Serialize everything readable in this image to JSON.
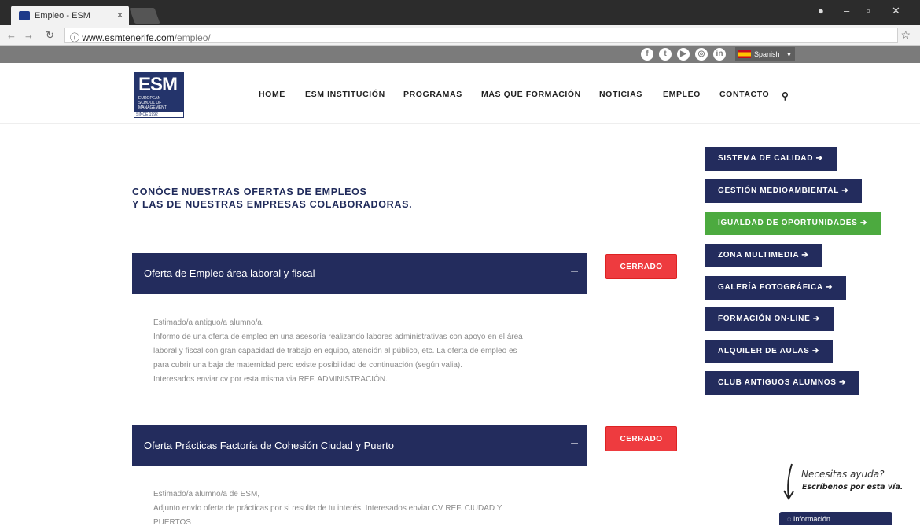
{
  "browser": {
    "tab_title": "Empleo - ESM",
    "tab_close": "×",
    "url_host": "www.esmtenerife.com",
    "url_path": "/empleo/"
  },
  "topstrip": {
    "language": "Spanish",
    "social": [
      "f",
      "t",
      "yt",
      "ig",
      "in"
    ]
  },
  "logo": {
    "big": "ESM",
    "small": "EUROPEAN\nSCHOOL OF\nMANAGEMENT",
    "since": "SINCE 1992"
  },
  "nav": {
    "items": [
      "HOME",
      "ESM INSTITUCIÓN",
      "PROGRAMAS",
      "MÁS QUE FORMACIÓN",
      "NOTICIAS",
      "EMPLEO",
      "CONTACTO"
    ]
  },
  "main": {
    "heading_line1": "CONÓCE NUESTRAS OFERTAS DE EMPLEOS",
    "heading_line2": "Y LAS DE NUESTRAS EMPRESAS COLABORADORAS.",
    "offers": [
      {
        "title": "Oferta de Empleo área laboral y fiscal",
        "status": "CERRADO",
        "lines": [
          "Estimado/a antiguo/a alumno/a.",
          "Informo de una oferta de empleo en una asesoría realizando labores administrativas con apoyo en el área",
          "laboral y fiscal con gran capacidad de trabajo en equipo, atención al público, etc. La oferta de empleo es",
          "para cubrir una baja de maternidad pero existe posibilidad de continuación (según valia).",
          "Interesados enviar cv por esta misma via REF. ADMINISTRACIÓN."
        ]
      },
      {
        "title": "Oferta Prácticas Factoría de Cohesión Ciudad y Puerto",
        "status": "CERRADO",
        "lines": [
          "Estimado/a alumno/a de ESM,",
          "Adjunto envío oferta de prácticas por si resulta de tu interés. Interesados enviar CV REF. CIUDAD Y",
          "PUERTOS"
        ]
      }
    ]
  },
  "sidebar": {
    "items": [
      {
        "label": "SISTEMA DE CALIDAD ➔"
      },
      {
        "label": "GESTIÓN MEDIOAMBIENTAL ➔"
      },
      {
        "label": "IGUALDAD DE OPORTUNIDADES ➔"
      },
      {
        "label": "ZONA MULTIMEDIA ➔"
      },
      {
        "label": "GALERÍA FOTOGRÁFICA ➔"
      },
      {
        "label": "FORMACIÓN ON-LINE ➔"
      },
      {
        "label": "ALQUILER DE AULAS ➔"
      },
      {
        "label": "CLUB ANTIGUOS ALUMNOS ➔"
      }
    ]
  },
  "help": {
    "line1": "Necesitas ayuda?",
    "line2": "Escríbenos por esta vía.",
    "info_button": "Información"
  },
  "colors": {
    "brand_navy": "#232c5d",
    "accent_green": "#4caa3f",
    "closed_red": "#ee3b3f"
  }
}
